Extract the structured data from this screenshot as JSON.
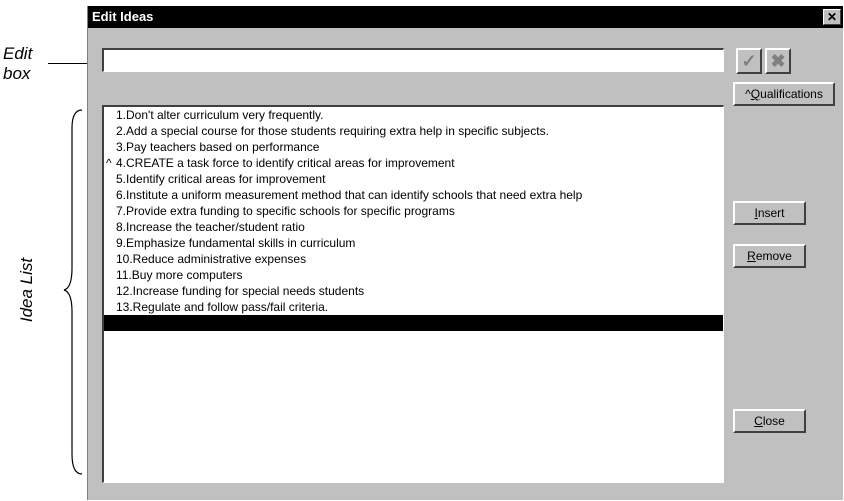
{
  "annotations": {
    "edit_box_line1": "Edit",
    "edit_box_line2": "box",
    "idea_list": "Idea List"
  },
  "window": {
    "title": "Edit Ideas",
    "close_glyph": "✕"
  },
  "edit_box": {
    "value": ""
  },
  "buttons": {
    "accept_glyph": "✓",
    "cancel_glyph": "✖",
    "qualifications": {
      "prefix": "^",
      "mnemonic": "Q",
      "rest": "ualifications"
    },
    "insert": {
      "mnemonic": "I",
      "rest": "nsert"
    },
    "remove": {
      "mnemonic": "R",
      "rest": "emove"
    },
    "close": {
      "mnemonic": "C",
      "rest": "lose"
    }
  },
  "ideas": [
    {
      "marker": "",
      "text": "1.Don't alter curriculum very frequently."
    },
    {
      "marker": "",
      "text": "2.Add a special course for those students requiring extra help in specific subjects."
    },
    {
      "marker": "",
      "text": "3.Pay teachers based on performance"
    },
    {
      "marker": "^",
      "text": "4.CREATE a task force to identify critical areas for improvement"
    },
    {
      "marker": "",
      "text": "5.Identify critical areas for improvement"
    },
    {
      "marker": "",
      "text": "6.Institute a uniform measurement method that can identify schools that need extra help"
    },
    {
      "marker": "",
      "text": "7.Provide extra funding to specific schools for specific programs"
    },
    {
      "marker": "",
      "text": "8.Increase the teacher/student ratio"
    },
    {
      "marker": "",
      "text": "9.Emphasize fundamental skills in curriculum"
    },
    {
      "marker": "",
      "text": "10.Reduce administrative expenses"
    },
    {
      "marker": "",
      "text": "11.Buy more computers"
    },
    {
      "marker": "",
      "text": "12.Increase funding for special needs students"
    },
    {
      "marker": "",
      "text": "13.Regulate and follow pass/fail criteria."
    },
    {
      "marker": "",
      "text": "",
      "selected": true
    }
  ]
}
